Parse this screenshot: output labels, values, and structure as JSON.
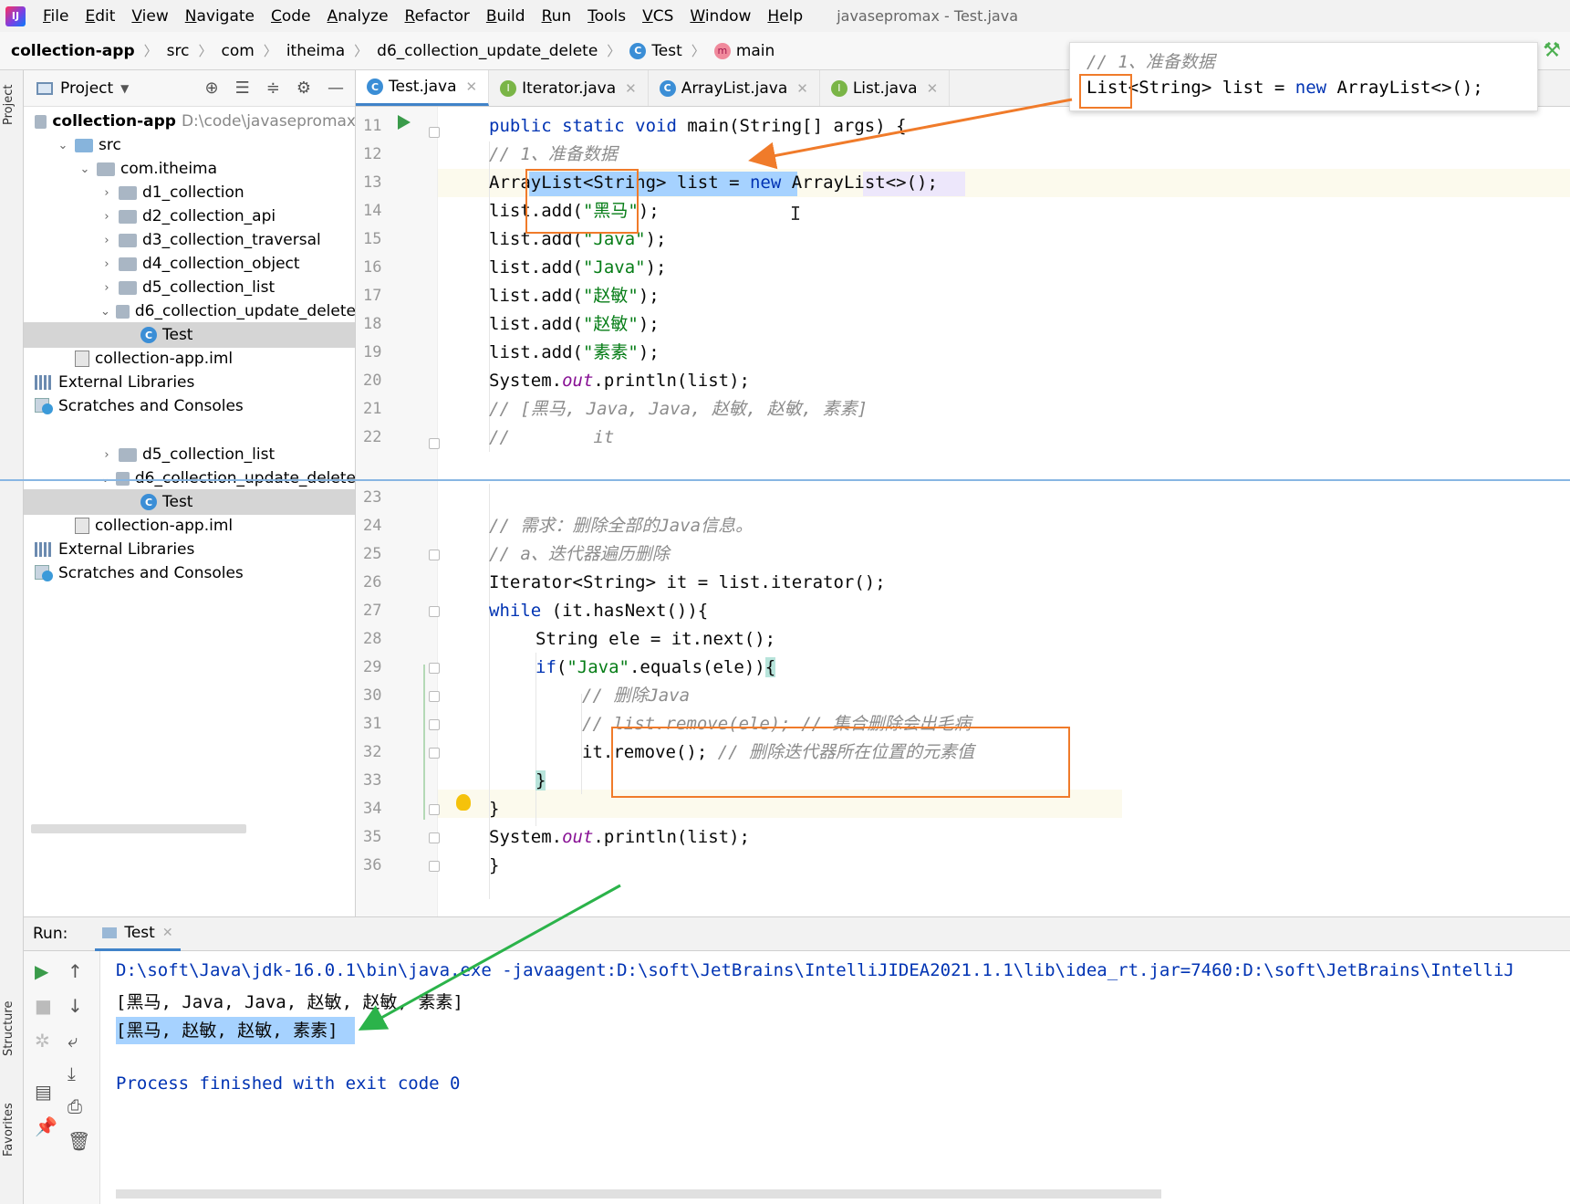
{
  "menu": {
    "items": [
      "File",
      "Edit",
      "View",
      "Navigate",
      "Code",
      "Analyze",
      "Refactor",
      "Build",
      "Run",
      "Tools",
      "VCS",
      "Window",
      "Help"
    ],
    "window_title": "javasepromax - Test.java"
  },
  "breadcrumb": {
    "project": "collection-app",
    "parts": [
      "src",
      "com",
      "itheima",
      "d6_collection_update_delete"
    ],
    "class_name": "Test",
    "method_name": "main",
    "class_badge": "C",
    "method_badge": "m"
  },
  "left_stripe": {
    "top_label": "Project",
    "structure_label": "Structure",
    "favorites_label": "Favorites"
  },
  "project_panel": {
    "title": "Project",
    "root": {
      "name": "collection-app",
      "path": "D:\\code\\javasepromax"
    },
    "tree_top": [
      {
        "name": "src",
        "type": "folder-blue",
        "indent": 1,
        "arrow": "open"
      },
      {
        "name": "com.itheima",
        "type": "package",
        "indent": 2,
        "arrow": "open"
      },
      {
        "name": "d1_collection",
        "type": "package",
        "indent": 3,
        "arrow": "closed"
      },
      {
        "name": "d2_collection_api",
        "type": "package",
        "indent": 3,
        "arrow": "closed"
      },
      {
        "name": "d3_collection_traversal",
        "type": "package",
        "indent": 3,
        "arrow": "closed"
      },
      {
        "name": "d4_collection_object",
        "type": "package",
        "indent": 3,
        "arrow": "closed"
      },
      {
        "name": "d5_collection_list",
        "type": "package",
        "indent": 3,
        "arrow": "closed"
      },
      {
        "name": "d6_collection_update_delete",
        "type": "package",
        "indent": 3,
        "arrow": "open"
      },
      {
        "name": "Test",
        "type": "class",
        "indent": 4,
        "arrow": "",
        "selected": true
      },
      {
        "name": "collection-app.iml",
        "type": "file",
        "indent": 1,
        "arrow": ""
      },
      {
        "name": "External Libraries",
        "type": "lib",
        "indent": 0,
        "arrow": ""
      },
      {
        "name": "Scratches and Consoles",
        "type": "scratch",
        "indent": 0,
        "arrow": ""
      }
    ],
    "tree_bottom": [
      {
        "name": "d5_collection_list",
        "type": "package",
        "indent": 3,
        "arrow": "closed"
      },
      {
        "name": "d6_collection_update_delete",
        "type": "package",
        "indent": 3,
        "arrow": "open"
      },
      {
        "name": "Test",
        "type": "class",
        "indent": 4,
        "arrow": "",
        "selected": true
      },
      {
        "name": "collection-app.iml",
        "type": "file",
        "indent": 1,
        "arrow": ""
      },
      {
        "name": "External Libraries",
        "type": "lib",
        "indent": 0,
        "arrow": ""
      },
      {
        "name": "Scratches and Consoles",
        "type": "scratch",
        "indent": 0,
        "arrow": ""
      }
    ]
  },
  "tabs": [
    {
      "name": "Test.java",
      "badge": "C",
      "active": true
    },
    {
      "name": "Iterator.java",
      "badge": "I",
      "active": false
    },
    {
      "name": "ArrayList.java",
      "badge": "C",
      "active": false
    },
    {
      "name": "List.java",
      "badge": "I",
      "active": false
    }
  ],
  "code_top": [
    {
      "ln": "11",
      "html": "<span class=\"kw\">public static void</span> main(String[] args) {",
      "indent": 0
    },
    {
      "ln": "12",
      "html": "<span class=\"cm\">// 1、准备数据</span>",
      "indent": 1
    },
    {
      "ln": "13",
      "html": "ArrayList&lt;String&gt; list = <span class=\"kw\">new</span> ArrayList&lt;&gt;();",
      "indent": 1
    },
    {
      "ln": "14",
      "html": "list.add(<span class=\"str\">\"黑马\"</span>);",
      "indent": 1
    },
    {
      "ln": "15",
      "html": "list.add(<span class=\"str\">\"Java\"</span>);",
      "indent": 1
    },
    {
      "ln": "16",
      "html": "list.add(<span class=\"str\">\"Java\"</span>);",
      "indent": 1
    },
    {
      "ln": "17",
      "html": "list.add(<span class=\"str\">\"赵敏\"</span>);",
      "indent": 1
    },
    {
      "ln": "18",
      "html": "list.add(<span class=\"str\">\"赵敏\"</span>);",
      "indent": 1
    },
    {
      "ln": "19",
      "html": "list.add(<span class=\"str\">\"素素\"</span>);",
      "indent": 1
    },
    {
      "ln": "20",
      "html": "System.<span class=\"fld\">out</span>.println(list);",
      "indent": 1
    },
    {
      "ln": "21",
      "html": "<span class=\"cm\">// [黑马, Java, Java, 赵敏, 赵敏, 素素]</span>",
      "indent": 1
    },
    {
      "ln": "22",
      "html": "<span class=\"cm\">//        it</span>",
      "indent": 1
    }
  ],
  "code_bottom": [
    {
      "ln": "23",
      "html": "",
      "indent": 1
    },
    {
      "ln": "24",
      "html": "<span class=\"cm\">// 需求：删除全部的Java信息。</span>",
      "indent": 1
    },
    {
      "ln": "25",
      "html": "<span class=\"cm\">// a、迭代器遍历删除</span>",
      "indent": 1
    },
    {
      "ln": "26",
      "html": "Iterator&lt;String&gt; it = list.iterator();",
      "indent": 1
    },
    {
      "ln": "27",
      "html": "<span class=\"kw\">while</span> (it.hasNext()){",
      "indent": 1
    },
    {
      "ln": "28",
      "html": "String ele = it.next();",
      "indent": 2
    },
    {
      "ln": "29",
      "html": "<span class=\"kw\">if</span>(<span class=\"str\">\"Java\"</span>.equals(ele))<span class=\"brace-hl\">{</span>",
      "indent": 2
    },
    {
      "ln": "30",
      "html": "<span class=\"cm\">// 删除Java</span>",
      "indent": 3
    },
    {
      "ln": "31",
      "html": "<span class=\"cm\">// list.remove(ele); // 集合删除会出毛病</span>",
      "indent": 3
    },
    {
      "ln": "32",
      "html": "it.remove(); <span class=\"cm\">// 删除迭代器所在位置的元素值</span>",
      "indent": 3
    },
    {
      "ln": "33",
      "html": "<span class=\"brace-hl\">}</span>",
      "indent": 2
    },
    {
      "ln": "34",
      "html": "}",
      "indent": 1
    },
    {
      "ln": "35",
      "html": "System.<span class=\"fld\">out</span>.println(list);",
      "indent": 1
    },
    {
      "ln": "36",
      "html": "}",
      "indent": 0
    }
  ],
  "popup": {
    "line1": "// 1、准备数据",
    "line2_html": "List&lt;String&gt; list = <span class=\"kw\">new</span> ArrayList&lt;&gt;();"
  },
  "run": {
    "label": "Run:",
    "tab": "Test",
    "console": [
      "D:\\soft\\Java\\jdk-16.0.1\\bin\\java.exe -javaagent:D:\\soft\\JetBrains\\IntelliJIDEA2021.1.1\\lib\\idea_rt.jar=7460:D:\\soft\\JetBrains\\IntelliJ",
      "[黑马, Java, Java, 赵敏, 赵敏, 素素]",
      "[黑马, 赵敏, 赵敏, 素素]",
      "",
      "Process finished with exit code 0"
    ]
  },
  "colors": {
    "annotation_orange": "#f07b2a",
    "annotation_green": "#2bb34a",
    "selection": "#a6d2ff"
  }
}
